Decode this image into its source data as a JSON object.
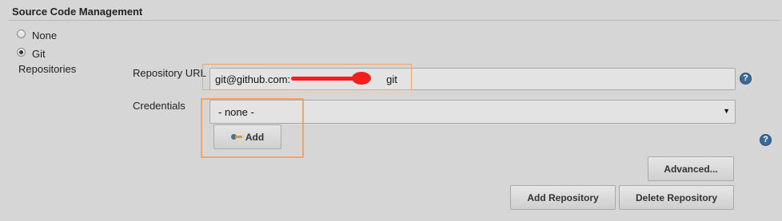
{
  "section": {
    "title": "Source Code Management"
  },
  "scm_options": [
    {
      "label": "None",
      "selected": false
    },
    {
      "label": "Git",
      "selected": true
    }
  ],
  "repositories_label": "Repositories",
  "repository_url": {
    "label": "Repository URL",
    "value_prefix": "git@github.com:",
    "value_suffix": "git"
  },
  "credentials": {
    "label": "Credentials",
    "selected": "- none -",
    "add_label": "Add"
  },
  "buttons": {
    "advanced": "Advanced...",
    "add_repository": "Add Repository",
    "delete_repository": "Delete Repository"
  },
  "help_icon_glyph": "?",
  "colors": {
    "annotation": "#f0a46c",
    "redaction": "#f31f1f",
    "help": "#3c6a98"
  }
}
